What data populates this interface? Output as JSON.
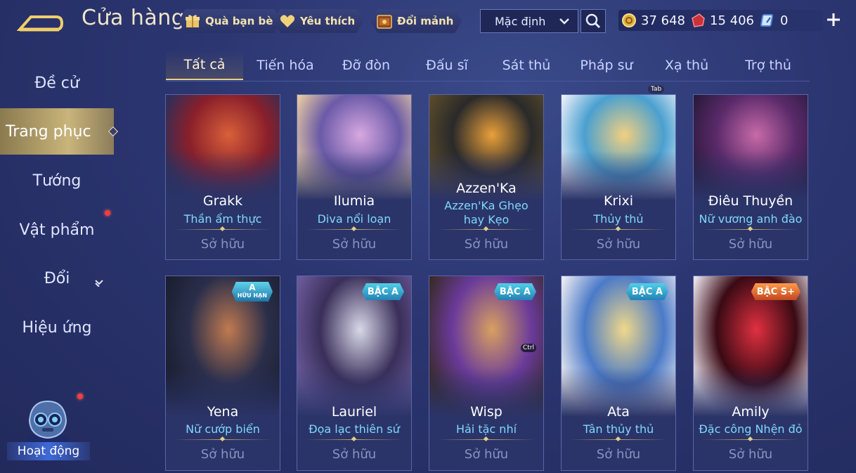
{
  "header": {
    "title": "Cửa hàng",
    "chips": [
      {
        "label": "Quà bạn bè",
        "icon": "gift-icon"
      },
      {
        "label": "Yêu thích",
        "icon": "heart-icon"
      },
      {
        "label": "Đổi mảnh",
        "icon": "shard-chest-icon"
      }
    ],
    "sort": {
      "selected": "Mặc định"
    },
    "currencies": [
      {
        "icon": "gold-coin-icon",
        "value": "37 648"
      },
      {
        "icon": "red-voucher-icon",
        "value": "15 406"
      },
      {
        "icon": "blue-gem-icon",
        "value": "0"
      }
    ]
  },
  "sidebar": {
    "items": [
      {
        "label": "Đề cử"
      },
      {
        "label": "Trang phục"
      },
      {
        "label": "Tướng"
      },
      {
        "label": "Vật phẩm"
      },
      {
        "label": "Đổi"
      },
      {
        "label": "Hiệu ứng"
      }
    ],
    "activity_label": "Hoạt động"
  },
  "tabs": [
    "Tất cả",
    "Tiến hóa",
    "Đỡ đòn",
    "Đấu sĩ",
    "Sát thủ",
    "Pháp sư",
    "Xạ thủ",
    "Trợ thủ"
  ],
  "hints": {
    "tab": "Tab",
    "ctrl": "Ctrl"
  },
  "cards": [
    {
      "hero": "Grakk",
      "skin": "Thần ẩm thực",
      "status": "Sở hữu",
      "badge": "",
      "palette": [
        "#8a1f2a",
        "#d8603a",
        "#2b2f5a"
      ]
    },
    {
      "hero": "Ilumia",
      "skin": "Diva nổi loạn",
      "status": "Sở hữu",
      "badge": "",
      "palette": [
        "#6a5aa8",
        "#d8a8e0",
        "#e6c9a0"
      ]
    },
    {
      "hero": "Azzen'Ka",
      "skin": "Azzen'Ka Ghẹo hay Kẹo",
      "status": "Sở hữu",
      "badge": "",
      "palette": [
        "#2a2a2a",
        "#e9a03a",
        "#5a4a2a"
      ]
    },
    {
      "hero": "Krixi",
      "skin": "Thủy thủ",
      "status": "Sở hữu",
      "badge": "",
      "palette": [
        "#4aa0d0",
        "#f2d080",
        "#e8eef8"
      ]
    },
    {
      "hero": "Điêu Thuyền",
      "skin": "Nữ vương anh đào",
      "status": "Sở hữu",
      "badge": "",
      "palette": [
        "#5a2a6a",
        "#c86aa8",
        "#2a1a3a"
      ]
    },
    {
      "hero": "Yena",
      "skin": "Nữ cướp biển",
      "status": "Sở hữu",
      "badge": {
        "line1": "A",
        "line2": "HỮU HẠN",
        "kind": "lim"
      },
      "palette": [
        "#2a2e4a",
        "#c07a50",
        "#1a1e30"
      ]
    },
    {
      "hero": "Lauriel",
      "skin": "Đọa lạc thiên sứ",
      "status": "Sở hữu",
      "badge": {
        "line1": "BẬC A",
        "kind": "a"
      },
      "palette": [
        "#3a2f5a",
        "#d8d8e8",
        "#6a5a9a"
      ]
    },
    {
      "hero": "Wisp",
      "skin": "Hải tặc nhí",
      "status": "Sở hữu",
      "badge": {
        "line1": "BẬC A",
        "kind": "a"
      },
      "palette": [
        "#6a3a9a",
        "#d8a060",
        "#3a2a2a"
      ]
    },
    {
      "hero": "Ata",
      "skin": "Tân thủy thủ",
      "status": "Sở hữu",
      "badge": {
        "line1": "BẬC A",
        "kind": "a"
      },
      "palette": [
        "#4a7ac8",
        "#f0d88a",
        "#eaeaf0"
      ]
    },
    {
      "hero": "Amily",
      "skin": "Đặc công Nhện đỏ",
      "status": "Sở hữu",
      "badge": {
        "line1": "BẬC S+",
        "kind": "s"
      },
      "palette": [
        "#3a0a14",
        "#e03040",
        "#e8e0e8"
      ]
    }
  ]
}
